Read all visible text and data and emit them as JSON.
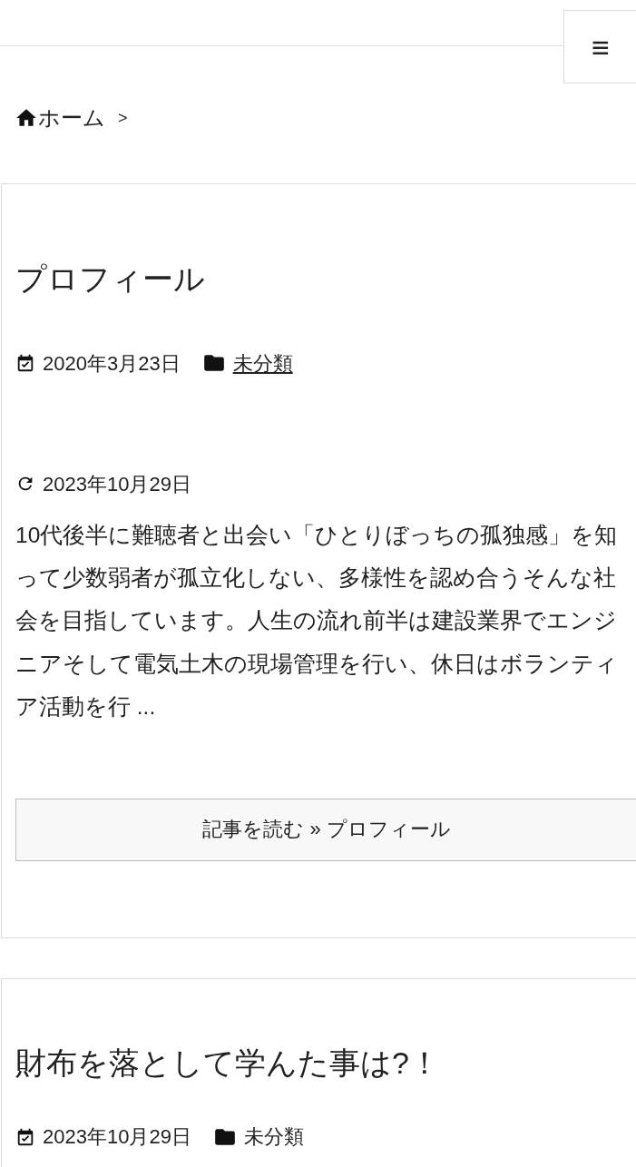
{
  "header": {
    "menu_button": "≡"
  },
  "breadcrumb": [
    {
      "label": "ホーム",
      "kind": "home"
    }
  ],
  "breadcrumb_separator": ">",
  "posts": [
    {
      "title": "プロフィール",
      "date": "2020年3月23日",
      "category": "未分類",
      "category_link": true,
      "updated": "2023年10月29日",
      "excerpt": "10代後半に難聴者と出会い「ひとりぼっちの孤独感」を知って少数弱者が孤立化しない、多様性を認め合うそんな社会を目指しています。人生の流れ前半は建設業界でエンジニアそして電気土木の現場管理を行い、休日はボランティア活動を行 ...",
      "read_more": "記事を読む » プロフィール"
    },
    {
      "title": "財布を落として学んた事は?！",
      "date": "2023年10月29日",
      "category": "未分類",
      "category_link": false
    }
  ]
}
